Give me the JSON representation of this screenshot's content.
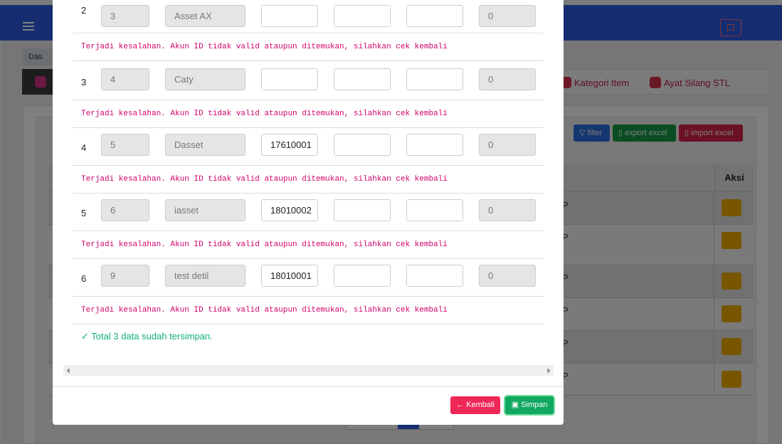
{
  "background": {
    "breadcrumb": "Das",
    "tabs": [
      {
        "label": "Kategori Item"
      },
      {
        "label": "Ayat Silang STL"
      }
    ],
    "buttons": {
      "filter": "filter",
      "export": "export excel",
      "import": "import excel"
    },
    "table": {
      "aksi_header": "Aksi",
      "row_text": "P"
    },
    "colors": {
      "topbar": "#2d5be3",
      "filter": "#2d6cdf",
      "export": "#149a45",
      "import": "#d6234a",
      "edit": "#f0ad00"
    }
  },
  "modal": {
    "rows": [
      {
        "no": "2",
        "id": "3",
        "name": "Asset AX",
        "akun": "",
        "f4": "",
        "f5": "",
        "val": "0",
        "error": "Terjadi kesalahan. Akun ID tidak valid ataupun ditemukan, silahkan cek kembali"
      },
      {
        "no": "3",
        "id": "4",
        "name": "Caty",
        "akun": "",
        "f4": "",
        "f5": "",
        "val": "0",
        "error": "Terjadi kesalahan. Akun ID tidak valid ataupun ditemukan, silahkan cek kembali"
      },
      {
        "no": "4",
        "id": "5",
        "name": "Dasset",
        "akun": "17610001",
        "f4": "",
        "f5": "",
        "val": "0",
        "error": "Terjadi kesalahan. Akun ID tidak valid ataupun ditemukan, silahkan cek kembali"
      },
      {
        "no": "5",
        "id": "6",
        "name": "iasset",
        "akun": "18010002",
        "f4": "",
        "f5": "",
        "val": "0",
        "error": "Terjadi kesalahan. Akun ID tidak valid ataupun ditemukan, silahkan cek kembali"
      },
      {
        "no": "6",
        "id": "9",
        "name": "test detil",
        "akun": "18010001",
        "f4": "",
        "f5": "",
        "val": "0",
        "error": "Terjadi kesalahan. Akun ID tidak valid ataupun ditemukan, silahkan cek kembali"
      }
    ],
    "success": "Total 3 data sudah tersimpan.",
    "buttons": {
      "back": "Kembali",
      "save": "Simpan"
    },
    "colors": {
      "error": "#d1006b",
      "success": "#10b070",
      "back": "#ee2757",
      "save": "#11a860"
    }
  }
}
